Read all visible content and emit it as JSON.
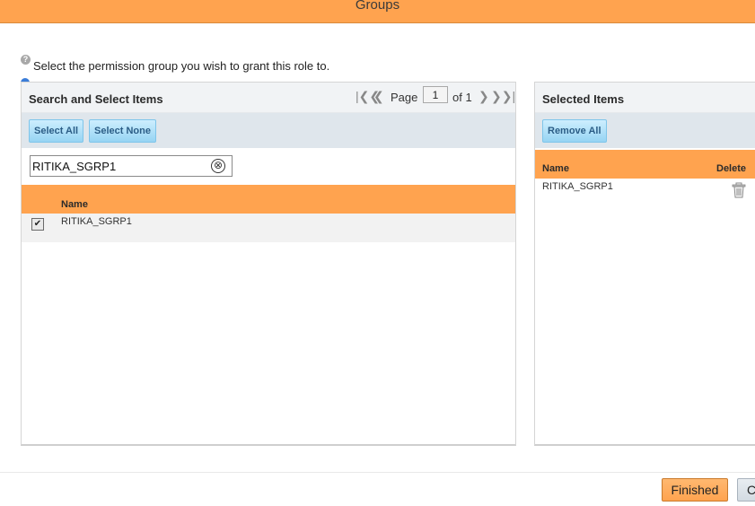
{
  "dialog": {
    "title": "Groups"
  },
  "instruction": "Select the permission group you wish to grant this role to.",
  "icons": {
    "help": "question-circle-icon",
    "info": "info-icon"
  },
  "left_panel": {
    "title": "Search and Select Items",
    "pager": {
      "page_label": "Page",
      "page_value": "1",
      "of_label": "of 1"
    },
    "toolbar": {
      "select_all": "Select All",
      "select_none": "Select None"
    },
    "search": {
      "value": "RITIKA_SGRP1",
      "clear_symbol": "⊗"
    },
    "columns": {
      "name": "Name"
    },
    "rows": [
      {
        "checked": true,
        "name": "RITIKA_SGRP1"
      }
    ]
  },
  "right_panel": {
    "title": "Selected Items",
    "toolbar": {
      "remove_all": "Remove All"
    },
    "columns": {
      "name": "Name",
      "delete": "Delete"
    },
    "rows": [
      {
        "name": "RITIKA_SGRP1"
      }
    ]
  },
  "footer": {
    "finished": "Finished",
    "cancel": "C"
  },
  "colors": {
    "accent_orange": "#ffa34f",
    "button_blue": "#96d4f3",
    "toolbar_bg": "#dfe6ec",
    "row_bg": "#f2f2f2"
  }
}
